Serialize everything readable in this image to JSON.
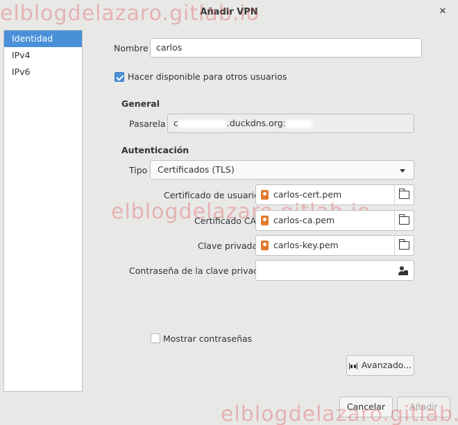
{
  "window": {
    "title": "Añadir VPN",
    "close": "✕",
    "watermark": "elblogdelazaro.gitlab.io"
  },
  "sidebar": {
    "items": [
      {
        "label": "Identidad",
        "active": true
      },
      {
        "label": "IPv4",
        "active": false
      },
      {
        "label": "IPv6",
        "active": false
      }
    ]
  },
  "identity": {
    "name_label": "Nombre",
    "name_value": "carlos",
    "share_label": "Hacer disponible para otros usuarios",
    "share_checked": true
  },
  "general": {
    "heading": "General",
    "gateway_label": "Pasarela",
    "gateway_value_prefix": "c",
    "gateway_value_suffix": ".duckdns.org:"
  },
  "auth": {
    "heading": "Autenticación",
    "type_label": "Tipo",
    "type_value": "Certificados (TLS)",
    "user_cert_label": "Certificado de usuario",
    "user_cert_value": "carlos-cert.pem",
    "ca_cert_label": "Certificado CA",
    "ca_cert_value": "carlos-ca.pem",
    "private_key_label": "Clave privada",
    "private_key_value": "carlos-key.pem",
    "key_password_label": "Contraseña de la clave privada",
    "key_password_value": ""
  },
  "options": {
    "show_passwords_label": "Mostrar contraseñas",
    "show_passwords_checked": false,
    "advanced_label": "Avanzado..."
  },
  "footer": {
    "cancel_label": "Cancelar",
    "add_label": "Añadir",
    "add_enabled": false
  }
}
